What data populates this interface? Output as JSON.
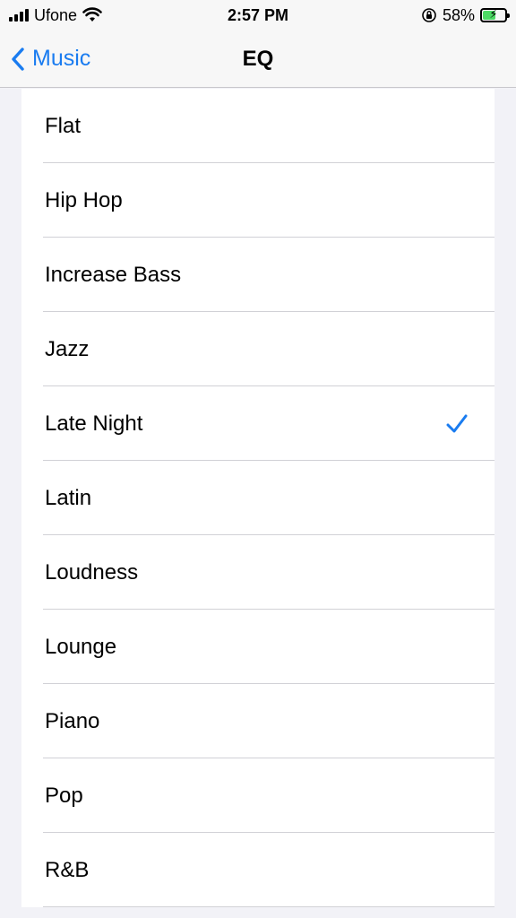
{
  "status_bar": {
    "carrier": "Ufone",
    "time": "2:57 PM",
    "battery_percent": "58%",
    "battery_level": 0.58
  },
  "nav": {
    "back_label": "Music",
    "title": "EQ"
  },
  "eq_presets": [
    {
      "label": "Flat",
      "selected": false
    },
    {
      "label": "Hip Hop",
      "selected": false
    },
    {
      "label": "Increase Bass",
      "selected": false
    },
    {
      "label": "Jazz",
      "selected": false
    },
    {
      "label": "Late Night",
      "selected": true
    },
    {
      "label": "Latin",
      "selected": false
    },
    {
      "label": "Loudness",
      "selected": false
    },
    {
      "label": "Lounge",
      "selected": false
    },
    {
      "label": "Piano",
      "selected": false
    },
    {
      "label": "Pop",
      "selected": false
    },
    {
      "label": "R&B",
      "selected": false
    }
  ],
  "colors": {
    "accent": "#1a7cf0",
    "battery_fill": "#4cd964"
  }
}
